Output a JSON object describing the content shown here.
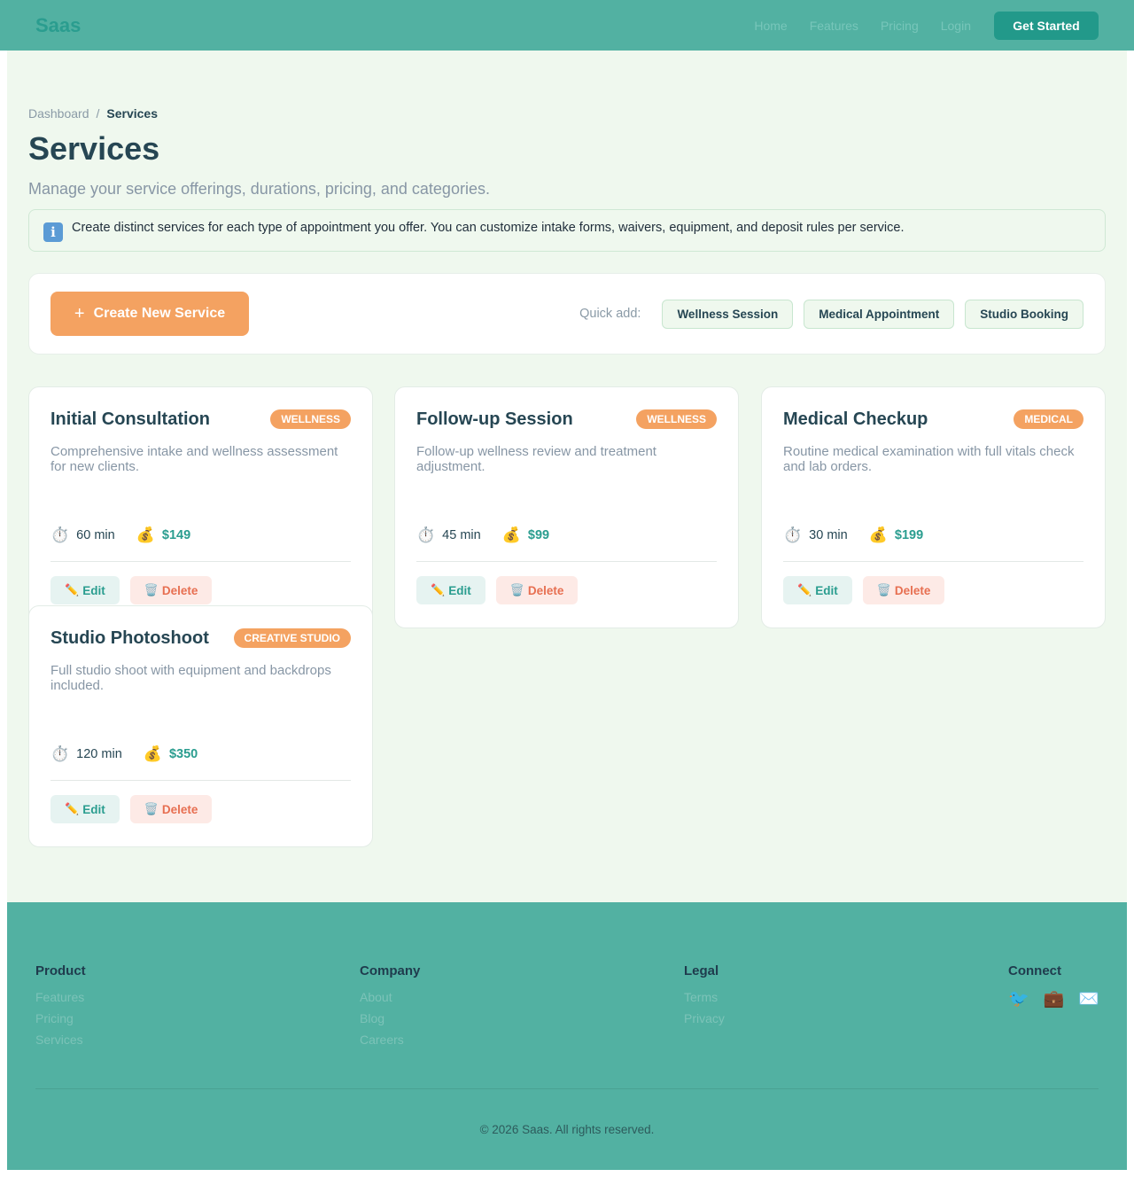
{
  "nav": {
    "brand": "Saas",
    "links": [
      "Home",
      "Features",
      "Pricing",
      "Login"
    ],
    "cta": "Get Started"
  },
  "breadcrumb": {
    "parent": "Dashboard",
    "separator": "/",
    "current": "Services"
  },
  "page": {
    "title": "Services",
    "subtitle": "Manage your service offerings, durations, pricing, and categories."
  },
  "info": {
    "icon": "info-icon",
    "glyph": "i",
    "text": "Create distinct services for each type of appointment you offer. You can customize intake forms, waivers, equipment, and deposit rules per service."
  },
  "toolbar": {
    "create_icon": "+",
    "create_label": "Create New Service",
    "quick_add_label": "Quick add:",
    "quick_add": [
      "Wellness Session",
      "Medical Appointment",
      "Studio Booking"
    ]
  },
  "services": [
    {
      "title": "Initial Consultation",
      "category": "WELLNESS",
      "description": "Comprehensive intake and wellness assessment for new clients.",
      "duration": "60 min",
      "price": "$149"
    },
    {
      "title": "Follow-up Session",
      "category": "WELLNESS",
      "description": "Follow-up wellness review and treatment adjustment.",
      "duration": "45 min",
      "price": "$99"
    },
    {
      "title": "Medical Checkup",
      "category": "MEDICAL",
      "description": "Routine medical examination with full vitals check and lab orders.",
      "duration": "30 min",
      "price": "$199"
    },
    {
      "title": "Studio Photoshoot",
      "category": "CREATIVE STUDIO",
      "description": "Full studio shoot with equipment and backdrops included.",
      "duration": "120 min",
      "price": "$350"
    }
  ],
  "card_labels": {
    "edit": "Edit",
    "delete": "Delete",
    "duration_icon": "⏱️",
    "price_icon": "💰",
    "edit_icon": "✏️",
    "delete_icon": "🗑️"
  },
  "footer": {
    "columns": [
      {
        "heading": "Product",
        "links": [
          "Features",
          "Pricing",
          "Services"
        ]
      },
      {
        "heading": "Company",
        "links": [
          "About",
          "Blog",
          "Careers"
        ]
      },
      {
        "heading": "Legal",
        "links": [
          "Terms",
          "Privacy"
        ]
      }
    ],
    "connect": {
      "heading": "Connect",
      "icons": [
        "🐦",
        "💼",
        "✉️"
      ]
    },
    "copyright": "© 2026 Saas. All rights reserved."
  },
  "colors": {
    "primary": "#2a9d8f",
    "accent": "#f4a261",
    "danger": "#e76f51",
    "dark": "#264653",
    "page_bg": "#eff8ee",
    "header_bg": "#52b1a2"
  }
}
